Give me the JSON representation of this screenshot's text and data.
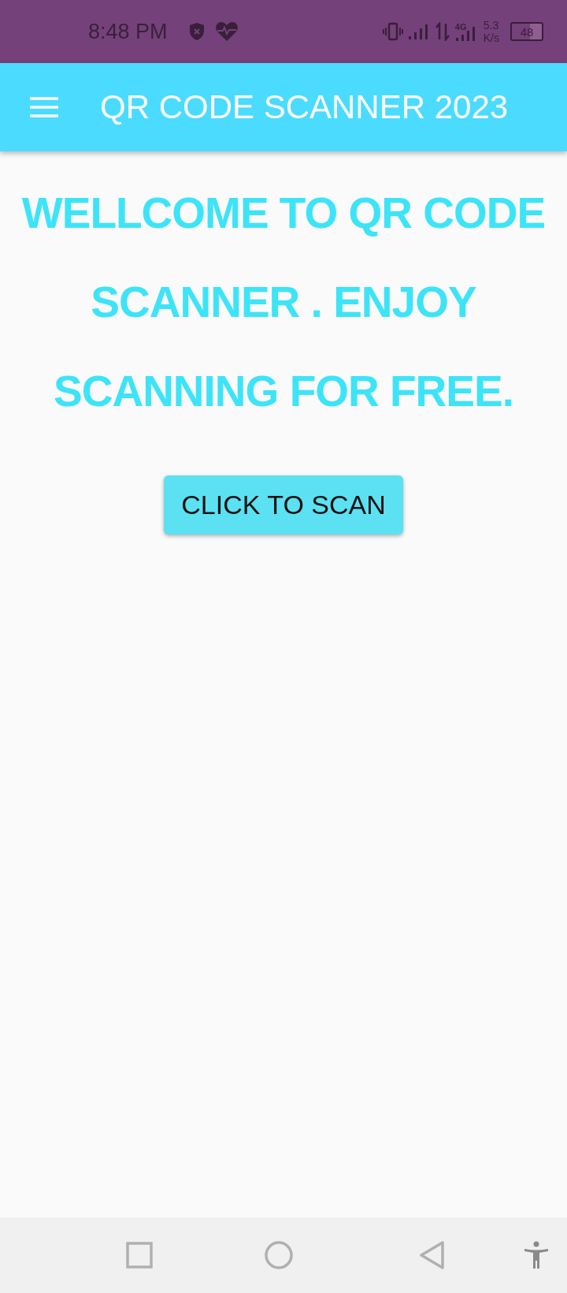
{
  "status_bar": {
    "time": "8:48 PM",
    "network_type": "4G",
    "speed_value": "5.3",
    "speed_unit": "K/s",
    "battery": "48"
  },
  "app_bar": {
    "title": "QR CODE SCANNER 2023"
  },
  "welcome_text": "WELLCOME TO QR CODE SCANNER . ENJOY SCANNING FOR FREE.",
  "scan_button": {
    "label": "CLICK TO SCAN"
  }
}
